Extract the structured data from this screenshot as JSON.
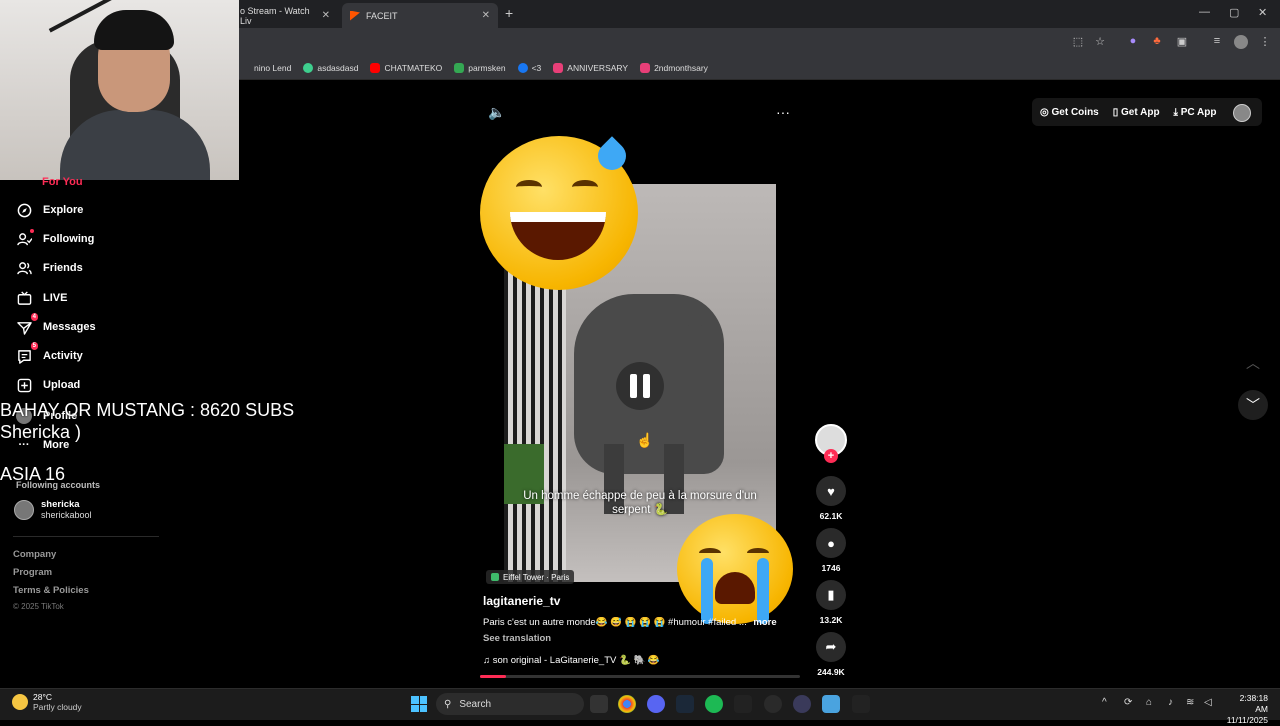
{
  "browser": {
    "tabs": [
      {
        "label": "o Stream - Watch Liv"
      },
      {
        "label": "FACEIT"
      }
    ],
    "new_tab": "+",
    "window_controls": {
      "minimize": "—",
      "maximize": "▢",
      "close": "✕"
    },
    "bookmarks": [
      {
        "label": "nino Lend",
        "color": "#35363a"
      },
      {
        "label": "asdasdasd",
        "color": "#3ecf8e"
      },
      {
        "label": "CHATMATEKO",
        "color": "#ff0000"
      },
      {
        "label": "parmsken",
        "color": "#34a853"
      },
      {
        "label": "<3",
        "color": "#1877f2"
      },
      {
        "label": "ANNIVERSARY",
        "color": "#e83f78"
      },
      {
        "label": "2ndmonthsary",
        "color": "#e83f78"
      }
    ]
  },
  "overlay": {
    "line1": "BAHAY OR MUSTANG : 8620 SUBS",
    "line2": "Shericka )",
    "line3": "ASIA 16"
  },
  "sidebar": {
    "for_you": "For You",
    "items": [
      {
        "label": "Explore",
        "icon": "compass-icon"
      },
      {
        "label": "Following",
        "icon": "user-follow-icon"
      },
      {
        "label": "Friends",
        "icon": "friends-icon"
      },
      {
        "label": "LIVE",
        "icon": "live-tv-icon"
      },
      {
        "label": "Messages",
        "icon": "send-icon",
        "badge": "4"
      },
      {
        "label": "Activity",
        "icon": "message-icon",
        "badge": "5"
      },
      {
        "label": "Upload",
        "icon": "plus-square-icon"
      },
      {
        "label": "Profile",
        "icon": "avatar-icon"
      },
      {
        "label": "More",
        "icon": "more-icon"
      }
    ],
    "following_title": "Following accounts",
    "following": [
      {
        "name": "shericka",
        "handle": "shericka​bool"
      }
    ],
    "footer": [
      "Company",
      "Program",
      "Terms & Policies"
    ],
    "copyright": "© 2025 TikTok"
  },
  "top_buttons": {
    "coins": "Get Coins",
    "app": "Get App",
    "pc": "PC App"
  },
  "video": {
    "subtitle": "Un homme échappe de peu à la morsure d'un serpent 🐍",
    "location": "Eiffel Tower · Paris",
    "username": "lagitanerie_tv",
    "description": "Paris c'est un autre monde😂 😅 😭 😭 😭 #humour #failed ...",
    "more": "more",
    "see_translation": "See translation",
    "music": "son original - LaGitanerie_TV 🐍 🐘 😂",
    "progress": 0.08
  },
  "actions": {
    "likes": "62.1K",
    "comments": "1746",
    "saves": "13.2K",
    "shares": "244.9K"
  },
  "taskbar": {
    "temp": "28°C",
    "weather": "Partly cloudy",
    "search": "Search",
    "time": "2:38:18 AM",
    "date": "11/11/2025"
  }
}
